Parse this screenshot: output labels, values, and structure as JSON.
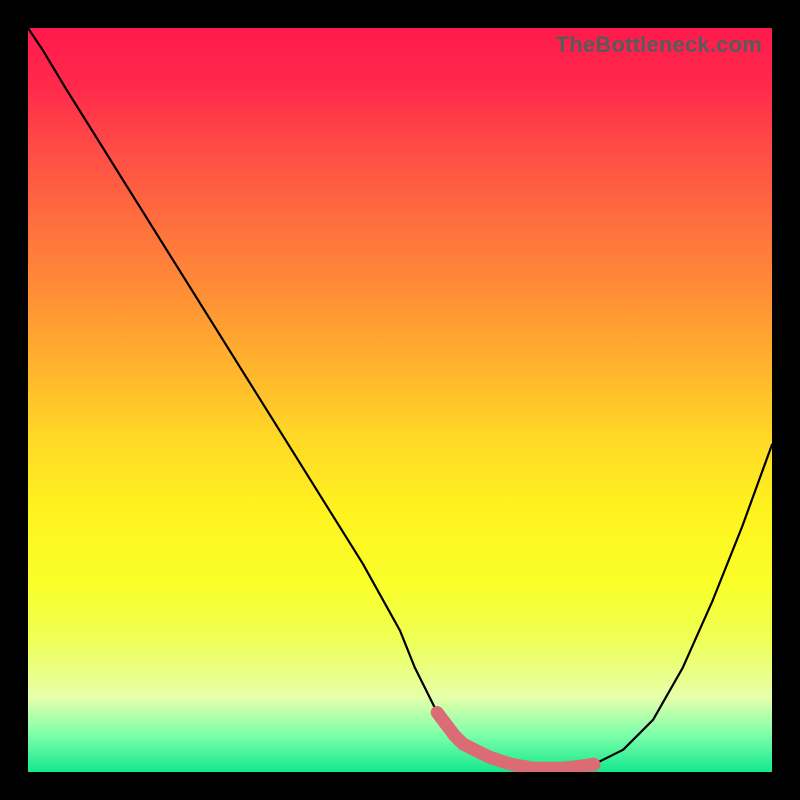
{
  "watermark": "TheBottleneck.com",
  "colors": {
    "frame": "#000000",
    "curve": "#000000",
    "marker": "#db6b74",
    "gradient_top": "#ff1a4d",
    "gradient_bottom": "#14e88c"
  },
  "chart_data": {
    "type": "line",
    "title": "",
    "xlabel": "",
    "ylabel": "",
    "xlim": [
      0,
      100
    ],
    "ylim": [
      0,
      100
    ],
    "x": [
      0,
      2,
      5,
      10,
      15,
      20,
      25,
      30,
      35,
      40,
      45,
      50,
      52,
      55,
      58,
      62,
      65,
      68,
      72,
      76,
      80,
      84,
      88,
      92,
      96,
      100
    ],
    "values": [
      100,
      97,
      92,
      84,
      76,
      68,
      60,
      52,
      44,
      36,
      28,
      19,
      14,
      8,
      4,
      2,
      1,
      0.5,
      0.5,
      1,
      3,
      7,
      14,
      23,
      33,
      44
    ],
    "annotations": {
      "flat_region_x": [
        55,
        76
      ],
      "marker_dot_x": 76
    }
  }
}
